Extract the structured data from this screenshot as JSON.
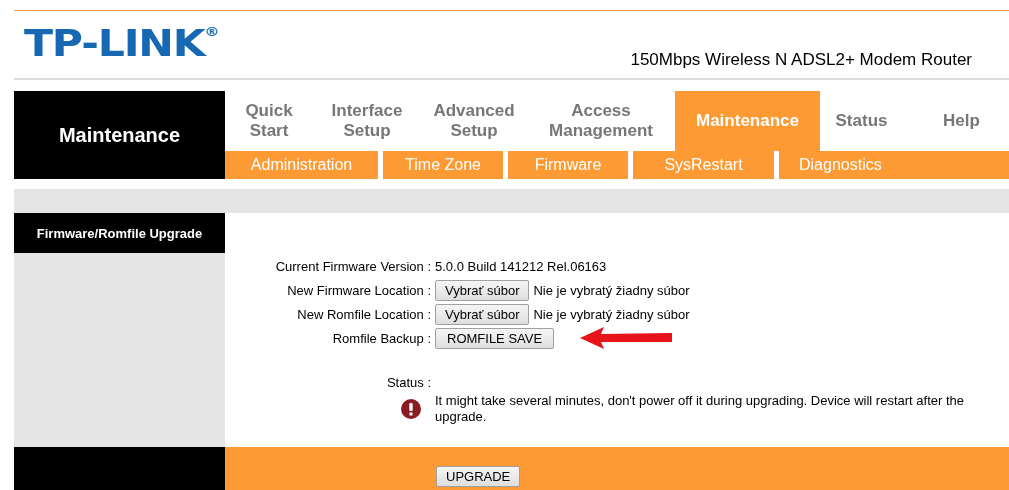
{
  "header": {
    "logo": "TP-LINK",
    "logo_mark": "®",
    "model": "150Mbps Wireless N ADSL2+ Modem Router"
  },
  "section_title": "Maintenance",
  "tabs": [
    {
      "label": "Quick Start",
      "selected": false
    },
    {
      "label": "Interface Setup",
      "selected": false
    },
    {
      "label": "Advanced Setup",
      "selected": false
    },
    {
      "label": "Access Management",
      "selected": false
    },
    {
      "label": "Maintenance",
      "selected": true
    },
    {
      "label": "Status",
      "selected": false
    },
    {
      "label": "Help",
      "selected": false
    }
  ],
  "subtabs": [
    {
      "label": "Administration",
      "selected": false
    },
    {
      "label": "Time Zone",
      "selected": false
    },
    {
      "label": "Firmware",
      "selected": false
    },
    {
      "label": "SysRestart",
      "selected": false
    },
    {
      "label": "Diagnostics",
      "selected": false
    }
  ],
  "panel_title": "Firmware/Romfile Upgrade",
  "rows": [
    {
      "kind": "text",
      "label": "Current Firmware Version :",
      "value": "5.0.0 Build 141212 Rel.06163"
    },
    {
      "kind": "file",
      "label": "New Firmware Location :",
      "button": "Vybrať súbor",
      "value": "Nie je vybratý žiadny súbor"
    },
    {
      "kind": "file",
      "label": "New Romfile Location :",
      "button": "Vybrať súbor",
      "value": "Nie je vybratý žiadny súbor"
    },
    {
      "kind": "button",
      "label": "Romfile Backup :",
      "button": "ROMFILE SAVE",
      "annotated": true
    }
  ],
  "status": {
    "label": "Status :",
    "message": "It might take several minutes, don't power off it during upgrading. Device will restart after the upgrade."
  },
  "footer_button": "UPGRADE"
}
